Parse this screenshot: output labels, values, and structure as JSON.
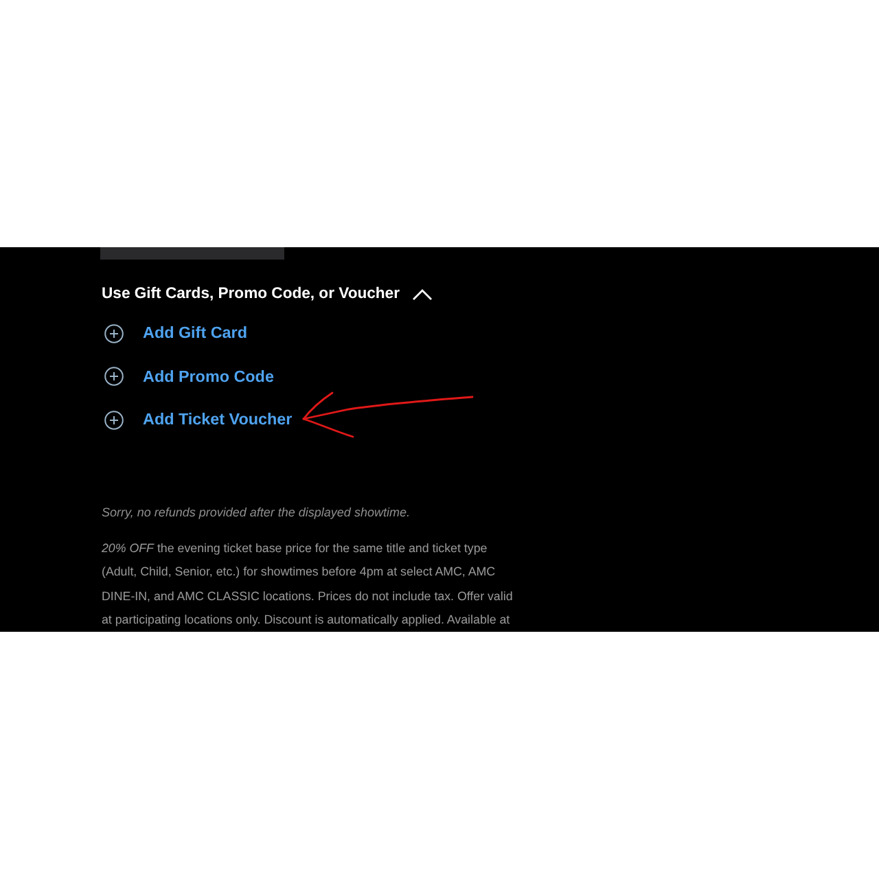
{
  "section": {
    "title": "Use Gift Cards, Promo Code, or Voucher",
    "expanded": true
  },
  "actions": [
    {
      "label": "Add Gift Card"
    },
    {
      "label": "Add Promo Code"
    },
    {
      "label": "Add Ticket Voucher"
    }
  ],
  "refund_note": "Sorry, no refunds provided after the displayed showtime.",
  "offer_text": "*20% OFF* the evening ticket base price for the same title and ticket type (Adult, Child, Senior, etc.) for showtimes before 4pm at select AMC, AMC DINE-IN, and AMC CLASSIC locations. Prices do not include tax. Offer valid at participating locations only. Discount is automatically applied. Available at"
}
